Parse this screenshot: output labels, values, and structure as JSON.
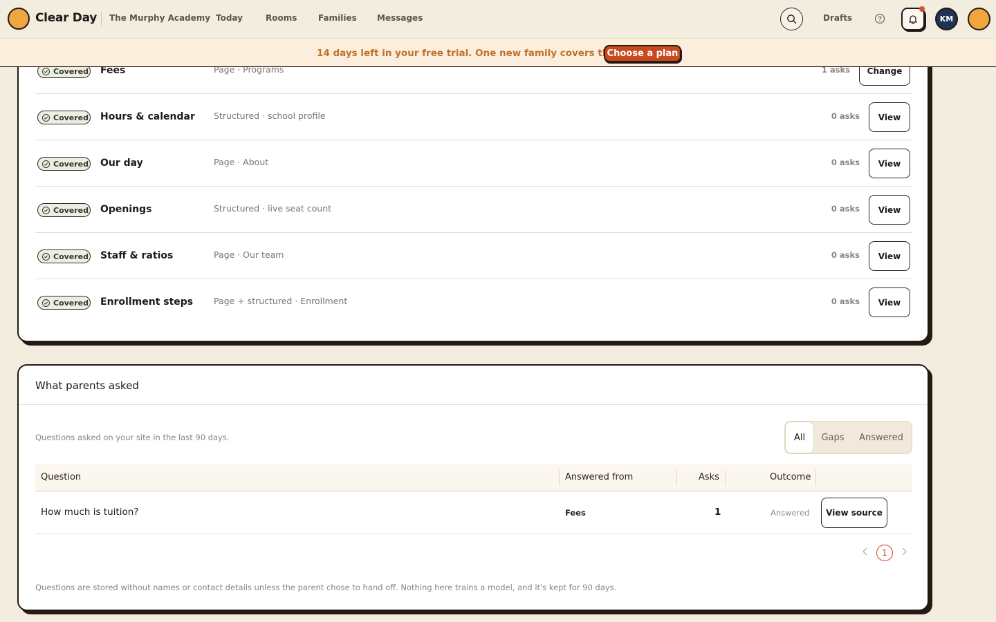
{
  "nav": {
    "brand": "Clear Day",
    "school": "The Murphy Academy",
    "links": [
      "Today",
      "Rooms",
      "Families",
      "Messages"
    ],
    "drafts": "Drafts",
    "avatar_initials": "KM"
  },
  "trial": {
    "text": "14 days left in your free trial. One new family covers the year.",
    "button": "Choose a plan"
  },
  "topics": [
    {
      "status": "Covered",
      "name": "Fees",
      "source": "Page · Programs",
      "asks": "1 asks",
      "action": "Change"
    },
    {
      "status": "Covered",
      "name": "Hours & calendar",
      "source": "Structured · school profile",
      "asks": "0 asks",
      "action": "View"
    },
    {
      "status": "Covered",
      "name": "Our day",
      "source": "Page · About",
      "asks": "0 asks",
      "action": "View"
    },
    {
      "status": "Covered",
      "name": "Openings",
      "source": "Structured · live seat count",
      "asks": "0 asks",
      "action": "View"
    },
    {
      "status": "Covered",
      "name": "Staff & ratios",
      "source": "Page · Our team",
      "asks": "0 asks",
      "action": "View"
    },
    {
      "status": "Covered",
      "name": "Enrollment steps",
      "source": "Page + structured · Enrollment",
      "asks": "0 asks",
      "action": "View"
    }
  ],
  "asked": {
    "title": "What parents asked",
    "subtitle": "Questions asked on your site in the last 90 days.",
    "filters": [
      "All",
      "Gaps",
      "Answered"
    ],
    "active_filter": "All",
    "columns": [
      "Question",
      "Answered from",
      "Asks",
      "Outcome"
    ],
    "rows": [
      {
        "question": "How much is tuition?",
        "answered_from": "Fees",
        "asks": "1",
        "outcome": "Answered",
        "action": "View source"
      }
    ],
    "page": "1",
    "privacy_note": "Questions are stored without names or contact details unless the parent chose to hand off. Nothing here trains a model, and it's kept for 90 days."
  },
  "colors": {
    "background": "#f3ede0",
    "accent": "#c9491f",
    "trial_text": "#c0722a",
    "brand_dot": "#efa73d",
    "avatar": "#1e3450",
    "covered_badge": "#e9f0e3"
  }
}
